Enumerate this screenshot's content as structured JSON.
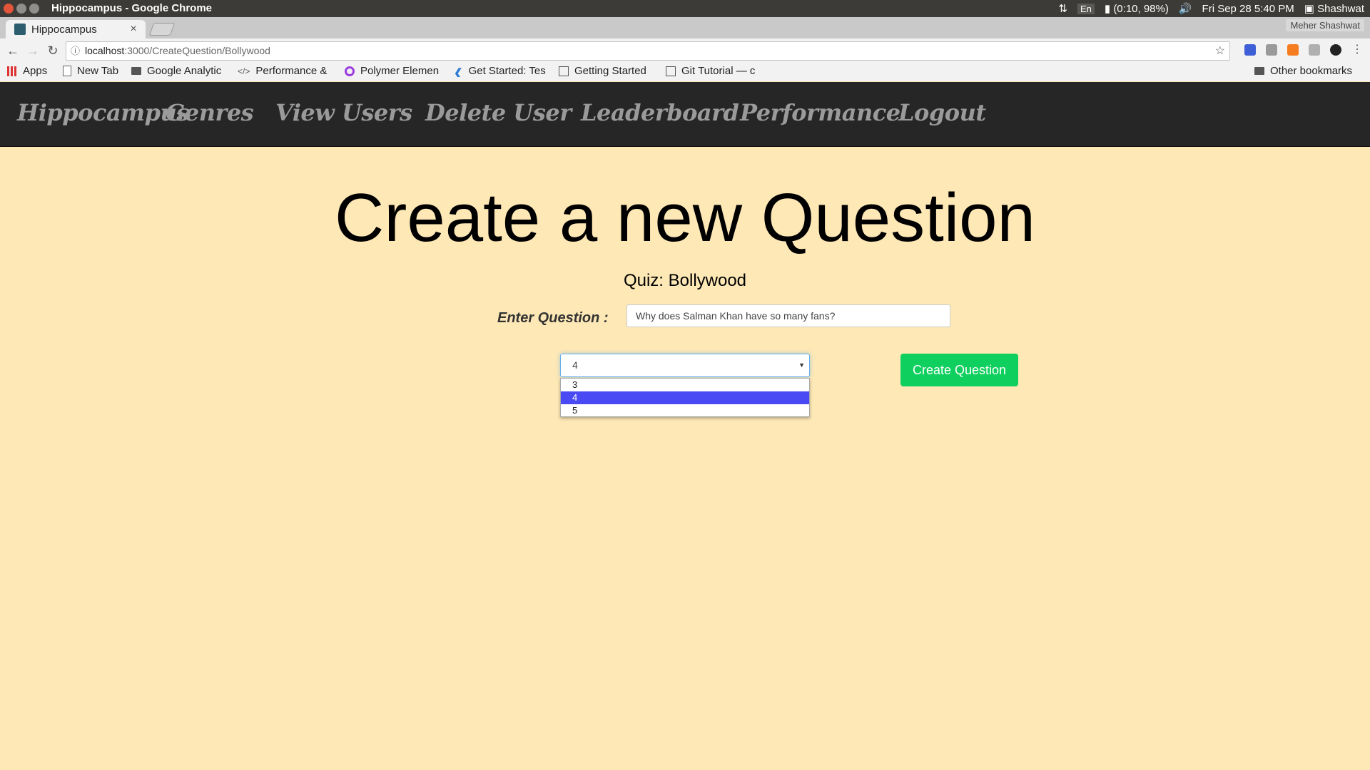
{
  "os": {
    "window_title": "Hippocampus - Google Chrome",
    "language": "En",
    "battery": "(0:10, 98%)",
    "datetime": "Fri Sep 28  5:40 PM",
    "user": "Shashwat"
  },
  "browser": {
    "tab_title": "Hippocampus",
    "profile_name": "Meher Shashwat",
    "url_host": "localhost",
    "url_path": ":3000/CreateQuestion/Bollywood",
    "bookmarks": [
      "Apps",
      "New Tab",
      "Google Analytic",
      "Performance &",
      "Polymer Elemen",
      "Get Started: Tes",
      "Getting Started",
      "Git Tutorial — c"
    ],
    "other_bookmarks": "Other bookmarks"
  },
  "nav": {
    "brand": "Hippocampus",
    "items": [
      "Genres",
      "View Users",
      "Delete User",
      "Leaderboard",
      "Performance",
      "Logout"
    ]
  },
  "main": {
    "heading": "Create a new Question",
    "quiz_label": "Quiz: Bollywood",
    "question_label": "Enter Question :",
    "question_value": "Why does Salman Khan have so many fans?",
    "select_value": "4",
    "options": [
      "3",
      "4",
      "5"
    ],
    "selected_option_index": 1,
    "create_button": "Create Question"
  },
  "colors": {
    "page_background": "#fde8b6",
    "navbar_background": "#262626",
    "button_green": "#0fcf5e",
    "option_highlight": "#4a4af4"
  }
}
